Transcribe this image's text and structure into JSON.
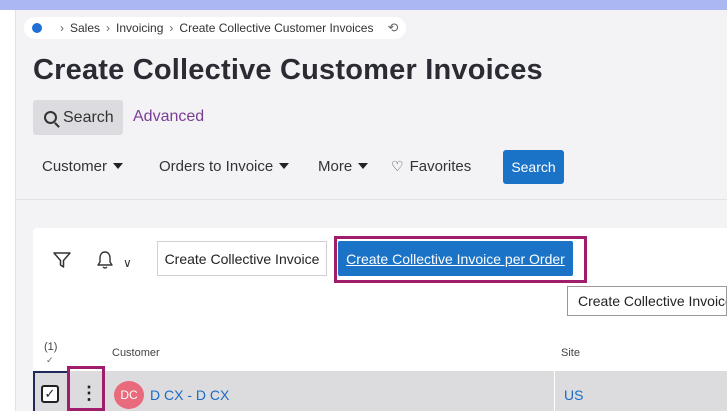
{
  "breadcrumb": {
    "items": [
      "Sales",
      "Invoicing",
      "Create Collective Customer Invoices"
    ],
    "home_icon": "home-dot-icon",
    "refresh_icon": "refresh-icon"
  },
  "page": {
    "title": "Create Collective Customer Invoices"
  },
  "search_tabs": {
    "search_label": "Search",
    "advanced_label": "Advanced"
  },
  "filters": {
    "items": [
      "Customer",
      "Orders to Invoice",
      "More"
    ],
    "favorites_label": "Favorites",
    "search_button_label": "Search"
  },
  "toolbar": {
    "create_collective_invoice_label": "Create Collective Invoice",
    "create_collective_invoice_per_order_label": "Create Collective Invoice per Order",
    "tooltip_text": "Create Collective Invoice"
  },
  "table": {
    "selected_count": "(1)",
    "select_all_mark": "✓",
    "columns": [
      "Customer",
      "Site"
    ],
    "rows": [
      {
        "checked_mark": "✓",
        "menu_glyph": "⋮",
        "avatar_initials": "DC",
        "customer": "D CX - D CX",
        "site": "US"
      }
    ]
  },
  "colors": {
    "accent": "#1a73c7",
    "highlight": "#a01d6c",
    "link": "#1a6bc4",
    "link_advanced": "#7a3d96"
  }
}
